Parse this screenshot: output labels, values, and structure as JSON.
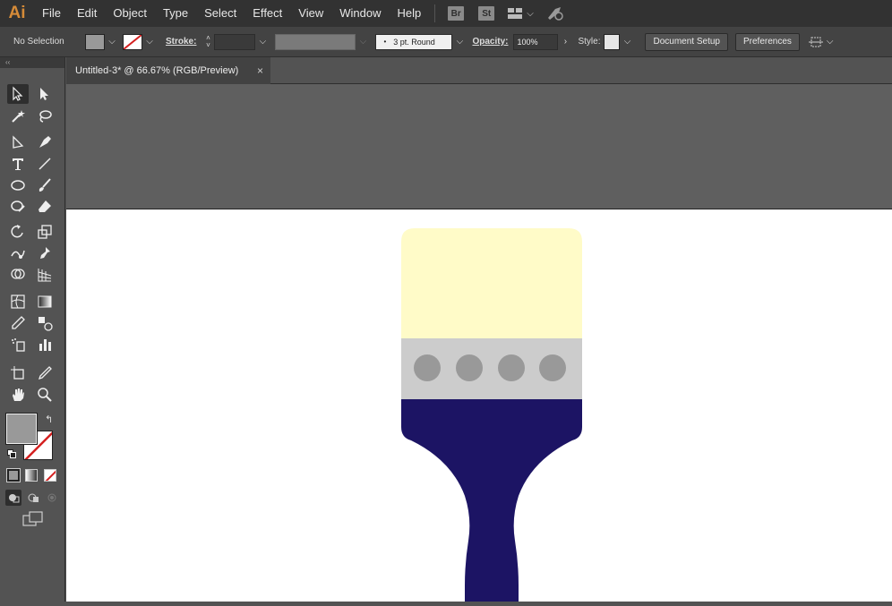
{
  "app": {
    "logo_text": "Ai"
  },
  "menu": [
    "File",
    "Edit",
    "Object",
    "Type",
    "Select",
    "Effect",
    "View",
    "Window",
    "Help"
  ],
  "app_badges": [
    "Br",
    "St"
  ],
  "control_bar": {
    "selection_label": "No Selection",
    "stroke_label": "Stroke:",
    "brush_value": "3 pt. Round",
    "opacity_label": "Opacity:",
    "opacity_value": "100%",
    "style_label": "Style:",
    "document_setup_label": "Document Setup",
    "preferences_label": "Preferences"
  },
  "document": {
    "tab_title": "Untitled-3* @ 66.67% (RGB/Preview)",
    "close_glyph": "×"
  },
  "colors": {
    "bristles": "#fffbc8",
    "ferrule": "#cccccc",
    "rivets": "#999999",
    "handle": "#1c1464",
    "fill_swatch": "#999999",
    "accent_logo": "#d68b38"
  }
}
